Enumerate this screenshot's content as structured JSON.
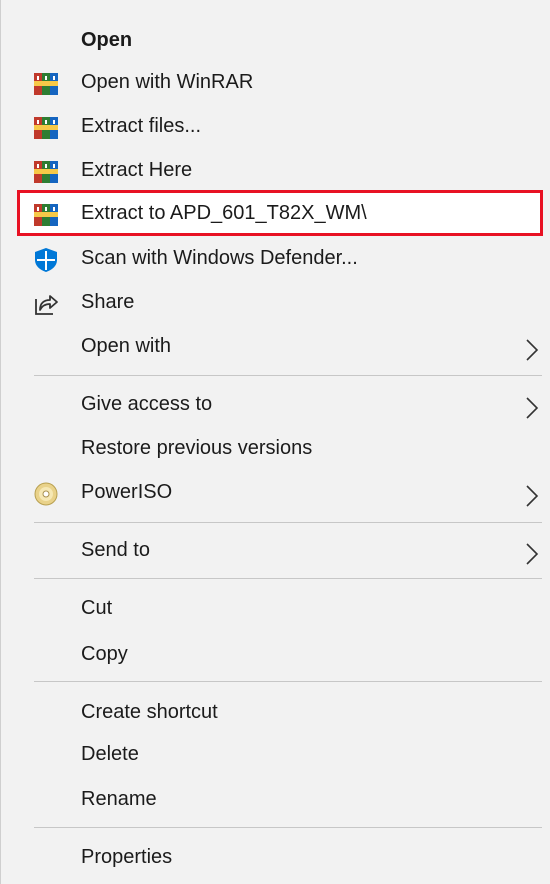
{
  "menu": {
    "open": "Open",
    "open_with_winrar": "Open with WinRAR",
    "extract_files": "Extract files...",
    "extract_here": "Extract Here",
    "extract_to": "Extract to APD_601_T82X_WM\\",
    "scan_defender": "Scan with Windows Defender...",
    "share": "Share",
    "open_with": "Open with",
    "give_access": "Give access to",
    "restore_versions": "Restore previous versions",
    "poweriso": "PowerISO",
    "send_to": "Send to",
    "cut": "Cut",
    "copy": "Copy",
    "create_shortcut": "Create shortcut",
    "delete": "Delete",
    "rename": "Rename",
    "properties": "Properties"
  },
  "icons": {
    "winrar": "winrar-icon",
    "defender": "shield-icon",
    "share": "share-icon",
    "poweriso": "disc-icon",
    "submenu": "chevron-right-icon"
  },
  "colors": {
    "highlight_border": "#e81123",
    "menu_background": "#f2f2f2",
    "defender_blue": "#0078d7"
  }
}
